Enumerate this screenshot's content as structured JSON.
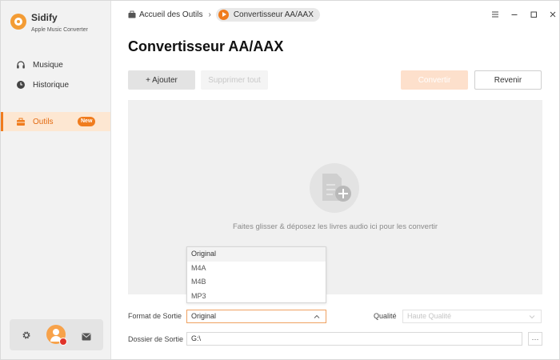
{
  "app": {
    "name": "Sidify",
    "subtitle": "Apple Music Converter"
  },
  "sidebar": {
    "items": [
      {
        "label": "Musique",
        "icon": "headphones-icon"
      },
      {
        "label": "Historique",
        "icon": "clock-icon"
      },
      {
        "label": "Outils",
        "icon": "toolbox-icon",
        "badge": "New",
        "active": true
      }
    ],
    "bottom": {
      "settings_icon": "gear-icon",
      "avatar_icon": "user-avatar-icon",
      "mail_icon": "mail-icon"
    }
  },
  "breadcrumb": {
    "home": "Accueil des Outils",
    "current": "Convertisseur AA/AAX"
  },
  "window_controls": [
    "menu-icon",
    "minimize-icon",
    "maximize-icon",
    "close-icon"
  ],
  "page": {
    "title": "Convertisseur AA/AAX"
  },
  "toolbar": {
    "add_label": "+ Ajouter",
    "delete_label": "Supprimer tout",
    "convert_label": "Convertir",
    "back_label": "Revenir"
  },
  "dropzone": {
    "text": "Faites glisser & déposez les livres audio ici pour les convertir"
  },
  "format": {
    "label": "Format de Sortie",
    "value": "Original",
    "options": [
      "Original",
      "M4A",
      "M4B",
      "MP3"
    ]
  },
  "quality": {
    "label": "Qualité",
    "placeholder": "Haute Qualité"
  },
  "folder": {
    "label": "Dossier de Sortie",
    "value": "G:\\",
    "browse_label": "···"
  },
  "colors": {
    "accent": "#f07c1e",
    "accent_light": "#fde7d2"
  }
}
